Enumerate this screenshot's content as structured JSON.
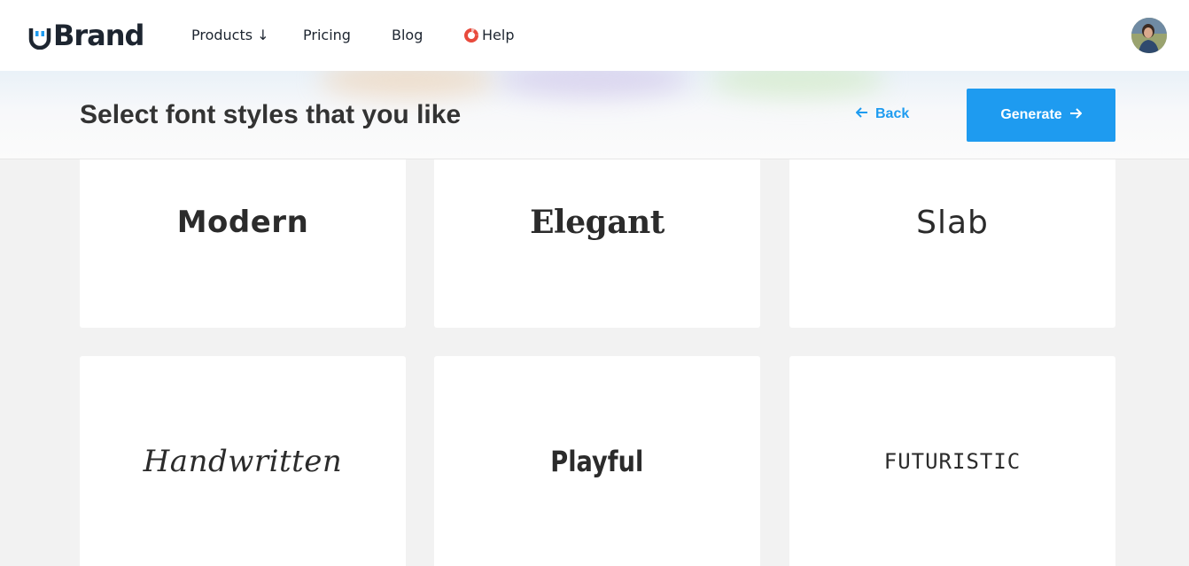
{
  "nav": {
    "logo": "Brand",
    "items": [
      "Products ↓",
      "Pricing",
      "Blog"
    ],
    "help": "Help"
  },
  "header": {
    "title": "Select font styles that you like",
    "back_label": "Back",
    "generate_label": "Generate"
  },
  "font_styles": [
    "Modern",
    "Elegant",
    "Slab",
    "Handwritten",
    "Playful",
    "FUTURISTIC"
  ],
  "colors": {
    "accent": "#1e9bf0",
    "text": "#333333",
    "background": "#f2f2f2"
  }
}
